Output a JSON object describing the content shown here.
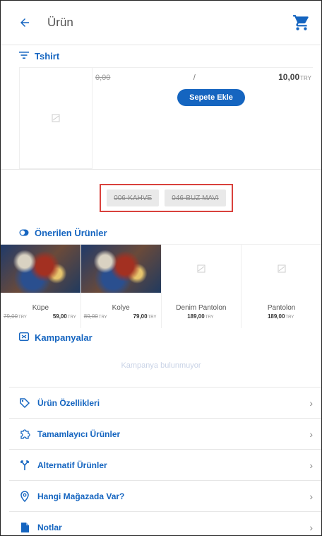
{
  "header": {
    "title": "Ürün",
    "back_icon": "arrow-left-icon",
    "cart_icon": "cart-icon"
  },
  "product": {
    "section_title": "Tshirt",
    "old_price": "0,00",
    "separator": "/",
    "price": "10,00",
    "currency": "TRY",
    "add_button": "Sepete Ekle"
  },
  "variants": [
    "006-KAHVE",
    "046-BUZ MAVI"
  ],
  "suggested": {
    "title": "Önerilen Ürünler",
    "items": [
      {
        "name": "Küpe",
        "old": "79,00",
        "price": "59,00",
        "currency": "TRY"
      },
      {
        "name": "Kolye",
        "old": "89,00",
        "price": "79,00",
        "currency": "TRY"
      },
      {
        "name": "Denim Pantolon",
        "price": "189,00",
        "currency": "TRY"
      },
      {
        "name": "Pantolon",
        "price": "189,00",
        "currency": "TRY"
      }
    ]
  },
  "campaigns": {
    "title": "Kampanyalar",
    "empty": "Kampanya bulunmuyor"
  },
  "menu": [
    {
      "label": "Ürün Özellikleri",
      "icon": "tag-icon"
    },
    {
      "label": "Tamamlayıcı Ürünler",
      "icon": "puzzle-icon"
    },
    {
      "label": "Alternatif Ürünler",
      "icon": "fork-icon"
    },
    {
      "label": "Hangi Mağazada Var?",
      "icon": "location-pin-icon"
    },
    {
      "label": "Notlar",
      "icon": "note-icon"
    }
  ],
  "colors": {
    "accent": "#1565c0",
    "highlight": "#d9413c"
  }
}
